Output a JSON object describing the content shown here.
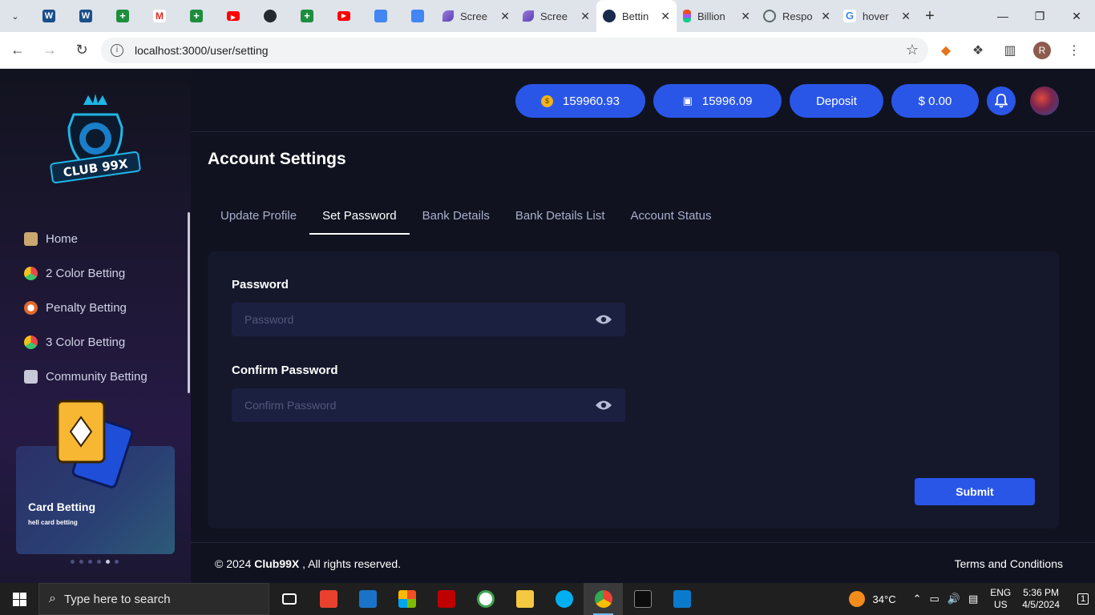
{
  "browser": {
    "pinned_tabs": [
      {
        "icon": "w-icon",
        "color": "#1a4f8b"
      },
      {
        "icon": "w-icon",
        "color": "#1a4f8b"
      },
      {
        "icon": "sheets-plus-icon",
        "color": "#1e8e3e"
      },
      {
        "icon": "gmail-icon",
        "color": "#d93025"
      },
      {
        "icon": "sheets-plus-icon",
        "color": "#1e8e3e"
      },
      {
        "icon": "youtube-icon",
        "color": "#ff0000"
      },
      {
        "icon": "github-icon",
        "color": "#24292f"
      },
      {
        "icon": "sheets-plus-icon",
        "color": "#1e8e3e"
      },
      {
        "icon": "youtube-icon",
        "color": "#ff0000"
      },
      {
        "icon": "docs-icon",
        "color": "#4285f4"
      },
      {
        "icon": "docs-icon",
        "color": "#4285f4"
      }
    ],
    "tabs": [
      {
        "title": "Scree",
        "icon": "feather-icon"
      },
      {
        "title": "Scree",
        "icon": "feather-icon"
      },
      {
        "title": "Bettin",
        "icon": "app-icon",
        "active": true
      },
      {
        "title": "Billion",
        "icon": "figma-icon"
      },
      {
        "title": "Respo",
        "icon": "openai-icon"
      },
      {
        "title": "hover",
        "icon": "google-icon"
      }
    ],
    "url": "localhost:3000/user/setting"
  },
  "brand": {
    "name": "CLUB 99X"
  },
  "sidebar": {
    "items": [
      {
        "label": "Home"
      },
      {
        "label": "2 Color Betting"
      },
      {
        "label": "Penalty Betting"
      },
      {
        "label": "3 Color Betting"
      },
      {
        "label": "Community Betting"
      }
    ],
    "promo": {
      "title": "Card Betting",
      "subtitle": "hell card betting"
    }
  },
  "header": {
    "coins": "159960.93",
    "wallet": "15996.09",
    "deposit_label": "Deposit",
    "balance": "$ 0.00"
  },
  "page": {
    "title": "Account Settings",
    "tabs": [
      {
        "label": "Update Profile"
      },
      {
        "label": "Set Password",
        "active": true
      },
      {
        "label": "Bank Details"
      },
      {
        "label": "Bank Details List"
      },
      {
        "label": "Account Status"
      }
    ],
    "form": {
      "password_label": "Password",
      "password_placeholder": "Password",
      "confirm_label": "Confirm Password",
      "confirm_placeholder": "Confirm Password",
      "submit_label": "Submit"
    }
  },
  "footer": {
    "copyright_prefix": "© 2024",
    "copyright_brand": "Club99X",
    "copyright_suffix": ", All rights reserved.",
    "terms": "Terms and Conditions"
  },
  "taskbar": {
    "search_placeholder": "Type here to search",
    "weather": "34°C",
    "lang_top": "ENG",
    "lang_bottom": "US",
    "time": "5:36 PM",
    "date": "4/5/2024",
    "notifications": "1"
  },
  "colors": {
    "accent": "#2a56e8",
    "panel": "#15182b",
    "page_bg": "#10121f",
    "input_bg": "#1c2040"
  }
}
